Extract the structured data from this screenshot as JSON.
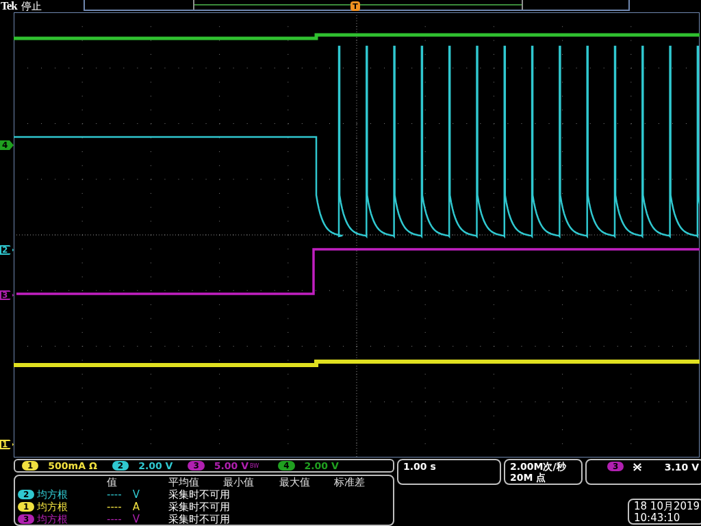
{
  "status": {
    "brand": "Tek",
    "state": "停止"
  },
  "trigger_marker": "T",
  "channel_markers": [
    {
      "label": "4",
      "color": "#20a020",
      "kind": "filled"
    },
    {
      "label": "2",
      "color": "#30c8d0",
      "kind": "outline"
    },
    {
      "label": "3",
      "color": "#b020b0",
      "kind": "outline"
    },
    {
      "label": "1",
      "color": "#f0e040",
      "kind": "outline"
    }
  ],
  "channels": [
    {
      "number": "1",
      "scale": "500mA Ω",
      "color": "#f0e040"
    },
    {
      "number": "2",
      "scale": "2.00 V",
      "color": "#30c8d0"
    },
    {
      "number": "3",
      "scale": "5.00 V",
      "color": "#b020b0",
      "bw_mark": "BW"
    },
    {
      "number": "4",
      "scale": "2.00 V",
      "color": "#20a020"
    }
  ],
  "timebase": "1.00 s",
  "acquisition": [
    "2.00M次/秒",
    "20M 点"
  ],
  "trigger": {
    "channel": "3",
    "color": "#b020b0",
    "level": "3.10 V"
  },
  "measurements": {
    "columns": [
      "值",
      "平均值",
      "最小值",
      "最大值",
      "标准差"
    ],
    "rows": [
      {
        "channel": "2",
        "color": "#30c8d0",
        "type": "均方根",
        "value": "----",
        "unit": "V",
        "status": "采集时不可用"
      },
      {
        "channel": "1",
        "color": "#f0e040",
        "type": "均方根",
        "value": "----",
        "unit": "A",
        "status": "采集时不可用"
      },
      {
        "channel": "3",
        "color": "#b020b0",
        "type": "均方根",
        "value": "----",
        "unit": "V",
        "status": "采集时不可用"
      }
    ]
  },
  "datetime": [
    "18 10月2019",
    "10:43:10"
  ]
}
